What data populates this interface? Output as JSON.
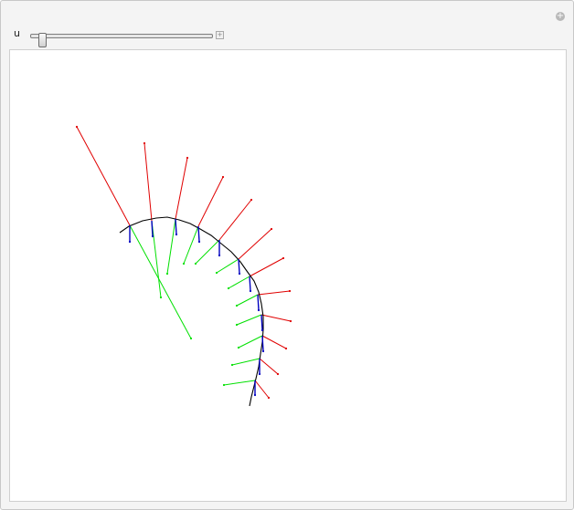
{
  "controls": {
    "u_label": "u",
    "u_slider_fraction": 0.03,
    "plus_glyph": "+"
  },
  "icons": {
    "corner_button": "plus-circle-icon",
    "slider_expand": "plus-square-icon"
  },
  "colors": {
    "curve": "#000000",
    "tangent": "#0000c0",
    "normal": "#00e000",
    "binormal": "#e00000"
  }
}
